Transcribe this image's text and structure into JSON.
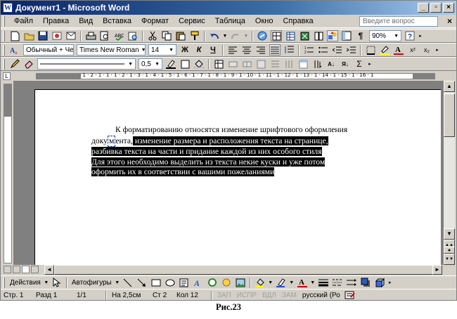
{
  "window": {
    "title": "Документ1 - Microsoft Word",
    "app_icon": "W",
    "buttons": [
      "_",
      "▫",
      "×"
    ]
  },
  "menu": {
    "items": [
      "Файл",
      "Правка",
      "Вид",
      "Вставка",
      "Формат",
      "Сервис",
      "Таблица",
      "Окно",
      "Справка"
    ],
    "help_placeholder": "Введите вопрос",
    "close": "×"
  },
  "standard_toolbar": {
    "zoom": "90%",
    "icons": [
      "new-icon",
      "open-icon",
      "save-icon",
      "permission-icon",
      "email-icon",
      "print-icon",
      "print-preview-icon",
      "spelling-icon",
      "research-icon",
      "cut-icon",
      "copy-icon",
      "paste-icon",
      "format-painter-icon",
      "undo-icon",
      "redo-icon",
      "hyperlink-icon",
      "tables-borders-icon",
      "insert-table-icon",
      "insert-excel-icon",
      "columns-icon",
      "drawing-icon",
      "document-map-icon",
      "show-marks-icon",
      "help-icon"
    ]
  },
  "format_toolbar": {
    "style": "Обычный + Чер",
    "font": "Times New Roman",
    "size": "14",
    "bold": "Ж",
    "italic": "К",
    "underline": "Ч"
  },
  "tables_toolbar": {
    "line_weight": "0,5"
  },
  "ruler": {
    "numbers": "· 1 · 2 · 1 · 1 · 1 · 2 · 1 · 3 · 1 · 4 · 1 · 5 · 1 · 6 · 1 · 7 · 1 · 8 · 1 · 9 · 1 · 10 · 1 · 11 · 1 · 12 · 1 · 13 · 1 · 14 · 1 · 15 · 1 · 16 · 1"
  },
  "document": {
    "line1": "К форматированию относятся изменение шрифтового оформления",
    "line2_pre": "доку",
    "line2_box": "м",
    "line2_mid": "ента,",
    "line2_sel": " изменение размера и расположения текста на странице,",
    "line3": "разбивка текста на части и придание каждой из них особого стиля",
    "line4": "Для этого необходимо выделить из текста некие куски и уже потом",
    "line5": "оформить их в соответствии с вашими пожеланиями"
  },
  "drawing_toolbar": {
    "actions": "Действия",
    "autoshapes": "Автофигуры"
  },
  "status": {
    "page": "Стр. 1",
    "section": "Разд 1",
    "pages": "1/1",
    "position": "На 2,5см",
    "line": "Ст 2",
    "column": "Кол 12",
    "rec": "ЗАП",
    "trk": "ИСПР",
    "ext": "ВДЛ",
    "ovr": "ЗАМ",
    "language": "русский (Ро"
  },
  "caption": "Рис.23",
  "colors": {
    "title_gradient_start": "#0a246a",
    "title_gradient_end": "#a6caf0",
    "chrome": "#d4d0c8",
    "workspace": "#808080",
    "selection": "#000000"
  }
}
